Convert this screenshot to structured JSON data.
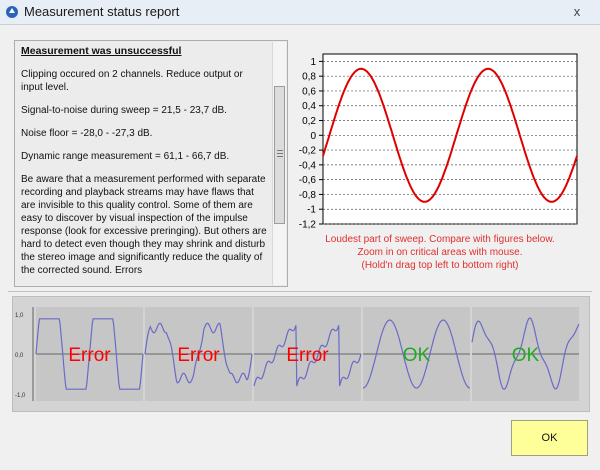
{
  "window": {
    "title": "Measurement status report",
    "close_glyph": "x"
  },
  "report": {
    "heading": "Measurement was unsuccessful",
    "paragraphs": [
      "Clipping occured on 2 channels. Reduce output or input level.",
      "Signal-to-noise during sweep = 21,5 - 23,7 dB.",
      "Noise floor = -28,0  -  -27,3 dB.",
      "Dynamic range measurement = 61,1 - 66,7 dB.",
      "Be aware that a measurement performed with separate recording and playback streams may have flaws that are invisible to this quality control. Some of them are easy to discover by visual inspection of the impulse response (look for excessive preringing). But others are hard to detect even though they may shrink and disturb the stereo image and significantly reduce the quality of the corrected sound. Errors"
    ]
  },
  "chart_data": {
    "type": "line",
    "yticks": [
      "1",
      "0,8",
      "0,6",
      "0,4",
      "0,2",
      "0",
      "-0,2",
      "-0,4",
      "-0,6",
      "-0,8",
      "-1",
      "-1,2"
    ],
    "ylim": [
      -1.2,
      1.1
    ],
    "color": "#e00000",
    "wave": {
      "amplitude": 0.9,
      "cycles": 2.0,
      "x_range": [
        0,
        1
      ]
    }
  },
  "caption": {
    "lines": [
      "Loudest part of sweep. Compare with figures below.",
      "Zoom in on critical areas with mouse.",
      "(Hold'n drag top left to bottom right)"
    ]
  },
  "examples": {
    "axis_labels": [
      "1,0",
      "0,0",
      "-1,0"
    ],
    "panels": [
      {
        "label": "Error",
        "status": "error"
      },
      {
        "label": "Error",
        "status": "error"
      },
      {
        "label": "Error",
        "status": "error"
      },
      {
        "label": "OK",
        "status": "ok"
      },
      {
        "label": "OK",
        "status": "ok"
      }
    ],
    "error_color": "#ff0000",
    "ok_color": "#22aa22",
    "wave_color": "#6a6ac8"
  },
  "ok_button": {
    "label": "OK",
    "color": "#ffff99"
  }
}
